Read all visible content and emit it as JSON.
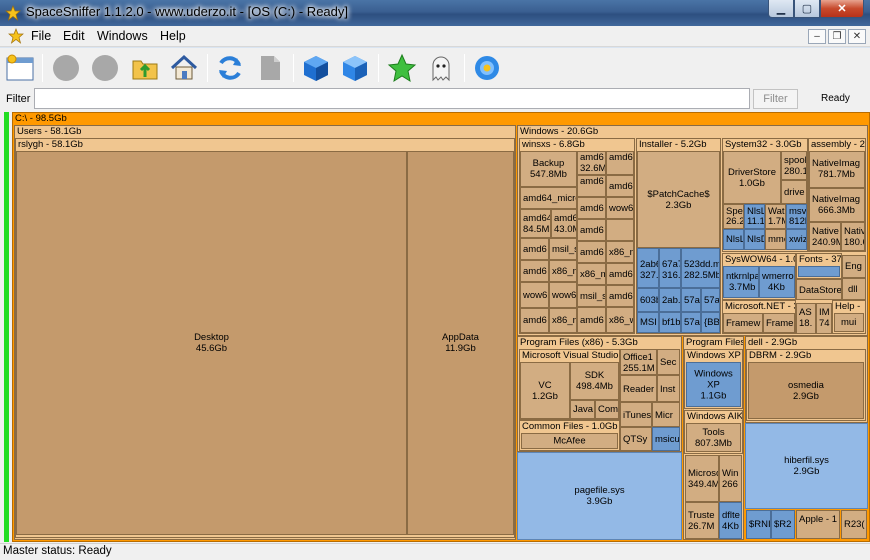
{
  "window": {
    "title": "SpaceSniffer 1.1.2.0 - www.uderzo.it - [OS (C:) - Ready]"
  },
  "menu": [
    "File",
    "Edit",
    "Windows",
    "Help"
  ],
  "toolbar_icons": [
    "new-scan-icon",
    "circle-disabled-icon",
    "circle-disabled-icon",
    "folder-up-icon",
    "home-icon",
    "refresh-icon",
    "file-icon",
    "cube-icon",
    "cube-filter-icon",
    "star-icon",
    "ghost-icon",
    "settings-flower-icon"
  ],
  "filter": {
    "label": "Filter",
    "value": "",
    "button": "Filter",
    "status": "Ready"
  },
  "treemap": {
    "root": "C:\\ - 98.5Gb",
    "users": "Users - 58.1Gb",
    "rslygh": "rslygh - 58.1Gb",
    "desktop": [
      "Desktop",
      "45.6Gb"
    ],
    "appdata": [
      "AppData",
      "11.9Gb"
    ],
    "windows": "Windows - 20.6Gb",
    "winsxs": "winsxs - 6.8Gb",
    "backup": [
      "Backup",
      "547.8Mb"
    ],
    "winsxs_items": [
      "amd6",
      "32.6M",
      "amd6",
      "amd64_micro",
      "amd6",
      "amd64",
      "84.5Ml",
      "amd6",
      "43.0M",
      "amd6",
      "wow6",
      "amd6",
      "msil_s",
      "amd6",
      "x86_m",
      "amd6",
      "amd6",
      "x86_m",
      "amd6",
      "x86_m",
      "wow6",
      "wow6",
      "msil_s",
      "amd6",
      "amd6",
      "x86_m",
      "amd6",
      "x86_w"
    ],
    "installer": "Installer - 5.2Gb",
    "patchcache": [
      "$PatchCache$",
      "2.3Gb"
    ],
    "installer_items": [
      "2ab6",
      "327.",
      "67a7",
      "316.",
      "523dd.ms",
      "282.5Mb",
      "603b",
      "2ab.",
      "57a3",
      "57a",
      "MSI",
      "bf1b",
      "57a3",
      "{BB"
    ],
    "system32": "System32 - 3.0Gb",
    "driverstore": [
      "DriverStore",
      "1.0Gb"
    ],
    "sys32_items": [
      "spool",
      "280.1",
      "drive",
      "Spe",
      "26.2",
      "NlsL",
      "11.1",
      "Wat",
      "1.7M",
      "msv",
      "812k",
      "NlsL",
      "NlsD",
      "mmc",
      "xwiz"
    ],
    "syswow": "SysWOW64 - 1.0",
    "syswow_items": [
      "ntkrnlpa",
      "3.7Mb",
      "wmerro",
      "4Kb"
    ],
    "fonts": "Fonts - 37",
    "fonts_items": [
      "Eng",
      "DataStore",
      "dll"
    ],
    "assembly": "assembly - 2",
    "assembly_items": [
      "NativeImag",
      "781.7Mb",
      "NativeImag",
      "666.3Mb",
      "Native",
      "240.9M",
      "Native",
      "180.6"
    ],
    "netfw": "Microsoft.NET - 3",
    "netfw_items": [
      "Framew",
      "Frame",
      "AS",
      "18.",
      "IM",
      "74",
      "Help -",
      "mui"
    ],
    "pf86": "Program Files (x86) - 5.3Gb",
    "mvs": "Microsoft Visual Studio",
    "vc": [
      "VC",
      "1.2Gb"
    ],
    "sdk": [
      "SDK",
      "498.4Mb"
    ],
    "mvs_items": [
      "Java",
      "Com"
    ],
    "pf86_items": [
      "Office1",
      "255.1M",
      "Sec",
      "Reader",
      "Inst",
      "iTunes",
      "Micr",
      "QTSy",
      "msicu"
    ],
    "common": "Common Files - 1.0Gb",
    "mcafee": "McAfee",
    "pagefile": [
      "pagefile.sys",
      "3.9Gb"
    ],
    "pf": "Program Files",
    "winxp_grp": "Windows XP",
    "winxp": [
      "Windows XP",
      "1.1Gb"
    ],
    "waik": "Windows AIK",
    "tools": [
      "Tools",
      "807.3Mb"
    ],
    "pf_items": [
      "Microso",
      "349.4M",
      "Win",
      "266",
      "Truste",
      "26.7M",
      "dflte",
      "4Kb"
    ],
    "dell": "dell - 2.9Gb",
    "dbrm": "DBRM - 2.9Gb",
    "osmedia": [
      "osmedia",
      "2.9Gb"
    ],
    "hiberfil": [
      "hiberfil.sys",
      "2.9Gb"
    ],
    "root_small": [
      "$RNI",
      "$R2",
      "Apple - 1",
      "R23("
    ]
  },
  "status": "Master status: Ready"
}
